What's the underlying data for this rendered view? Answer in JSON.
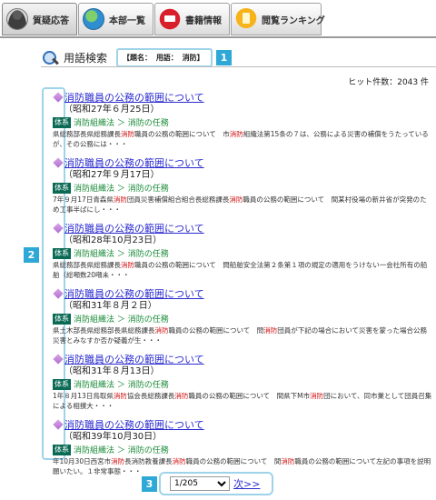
{
  "tabs": [
    {
      "label": "質疑応答",
      "icon": "person-icon",
      "active": true
    },
    {
      "label": "本部一覧",
      "icon": "globe-icon",
      "active": false
    },
    {
      "label": "書籍情報",
      "icon": "book-icon",
      "active": false
    },
    {
      "label": "閲覧ランキング",
      "icon": "ranking-icon",
      "active": false
    }
  ],
  "search": {
    "title": "用語検索",
    "cond_label1": "【題名：",
    "cond_label2": "用語：",
    "cond_value": "消防】"
  },
  "callouts": {
    "one": "1",
    "two": "2",
    "three": "3"
  },
  "hit_count": "ヒット件数：2043 件",
  "results": [
    {
      "title": "消防職員の公務の範囲について",
      "date": "（昭和27年６月25日）",
      "category_badge": "体系",
      "category": "消防組織法 ＞ 消防の任務",
      "snippet_parts": [
        {
          "t": "県総務部長県総務課長"
        },
        {
          "t": "消防",
          "hl": true
        },
        {
          "t": "職員の公務の範囲について　市"
        },
        {
          "t": "消防",
          "hl": true
        },
        {
          "t": "組織法第15条の７は、公務による災害の補償をうたっているが、その公務には・・・"
        }
      ]
    },
    {
      "title": "消防職員の公務の範囲について",
      "date": "（昭和27年９月17日）",
      "category_badge": "体系",
      "category": "消防組織法 ＞ 消防の任務",
      "snippet_parts": [
        {
          "t": "7年９月17日青森県"
        },
        {
          "t": "消防",
          "hl": true
        },
        {
          "t": "団員災害補償組合組合長総務課長"
        },
        {
          "t": "消防",
          "hl": true
        },
        {
          "t": "職員の公務の範囲について　間某村役場の新井省が突発のため工事半ばにし・・・"
        }
      ]
    },
    {
      "title": "消防職員の公務の範囲について",
      "date": "（昭和28年10月23日）",
      "category_badge": "体系",
      "category": "消防組織法 ＞ 消防の任務",
      "snippet_parts": [
        {
          "t": "県総務部長県総務課長"
        },
        {
          "t": "消防",
          "hl": true
        },
        {
          "t": "職員の公務の範囲について　問船舶安全法第２条第１項の規定の適用をうけない一会社所有の船舶（総噸数20噸未・・・"
        }
      ]
    },
    {
      "title": "消防職員の公務の範囲について",
      "date": "（昭和31年８月２日）",
      "category_badge": "体系",
      "category": "消防組織法 ＞ 消防の任務",
      "snippet_parts": [
        {
          "t": "県土木部長県総務部長県総務課長"
        },
        {
          "t": "消防",
          "hl": true
        },
        {
          "t": "職員の公務の範囲について　問"
        },
        {
          "t": "消防",
          "hl": true
        },
        {
          "t": "団員が下記の場合において災害を蒙った場合公務災害とみなすか否か疑義が生・・・"
        }
      ]
    },
    {
      "title": "消防職員の公務の範囲について",
      "date": "（昭和31年８月13日）",
      "category_badge": "体系",
      "category": "消防組織法 ＞ 消防の任務",
      "snippet_parts": [
        {
          "t": "1年８月13日鳥取県"
        },
        {
          "t": "消防",
          "hl": true
        },
        {
          "t": "協会長総務課長"
        },
        {
          "t": "消防",
          "hl": true
        },
        {
          "t": "職員の公務の範囲について　間県下M市"
        },
        {
          "t": "消防",
          "hl": true
        },
        {
          "t": "団において、同市業として団員召集による相撲大・・・"
        }
      ]
    },
    {
      "title": "消防職員の公務の範囲について",
      "date": "（昭和39年10月30日）",
      "category_badge": "体系",
      "category": "消防組織法 ＞ 消防の任務",
      "snippet_parts": [
        {
          "t": "年10月30日西宮市"
        },
        {
          "t": "消防",
          "hl": true
        },
        {
          "t": "長消防教養課長"
        },
        {
          "t": "消防",
          "hl": true
        },
        {
          "t": "職員の公務の範囲について　間"
        },
        {
          "t": "消防",
          "hl": true
        },
        {
          "t": "職員の公務の範囲について左記の事項を説明願いたい。１非常事態・・・"
        }
      ]
    }
  ],
  "pager": {
    "current": "1/205",
    "next_label": "次>>"
  }
}
